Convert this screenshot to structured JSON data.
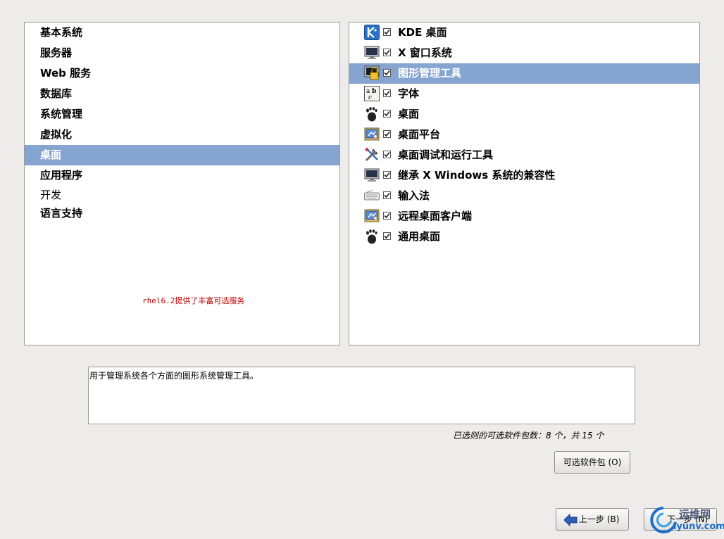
{
  "categories": [
    {
      "label": "基本系统",
      "selected": false,
      "bold": true
    },
    {
      "label": "服务器",
      "selected": false,
      "bold": true
    },
    {
      "label": "Web 服务",
      "selected": false,
      "bold": true
    },
    {
      "label": "数据库",
      "selected": false,
      "bold": true
    },
    {
      "label": "系统管理",
      "selected": false,
      "bold": true
    },
    {
      "label": "虚拟化",
      "selected": false,
      "bold": true
    },
    {
      "label": "桌面",
      "selected": true,
      "bold": true
    },
    {
      "label": "应用程序",
      "selected": false,
      "bold": true
    },
    {
      "label": "开发",
      "selected": false,
      "bold": false
    },
    {
      "label": "语言支持",
      "selected": false,
      "bold": true
    }
  ],
  "annotation": "rhel6.2提供了丰富可选服务",
  "groups": [
    {
      "label": "KDE 桌面",
      "icon": "kde-icon",
      "checked": true,
      "selected": false
    },
    {
      "label": "X 窗口系统",
      "icon": "monitor-icon",
      "checked": true,
      "selected": false
    },
    {
      "label": "图形管理工具",
      "icon": "lock-screen-icon",
      "checked": true,
      "selected": true
    },
    {
      "label": "字体",
      "icon": "font-icon",
      "checked": true,
      "selected": false
    },
    {
      "label": "桌面",
      "icon": "gnome-foot-icon",
      "checked": true,
      "selected": false
    },
    {
      "label": "桌面平台",
      "icon": "desktop-platform-icon",
      "checked": true,
      "selected": false
    },
    {
      "label": "桌面调试和运行工具",
      "icon": "tools-icon",
      "checked": true,
      "selected": false
    },
    {
      "label": "继承 X Windows 系统的兼容性",
      "icon": "monitor-icon",
      "checked": true,
      "selected": false
    },
    {
      "label": "输入法",
      "icon": "keyboard-icon",
      "checked": true,
      "selected": false
    },
    {
      "label": "远程桌面客户端",
      "icon": "desktop-platform-icon",
      "checked": true,
      "selected": false
    },
    {
      "label": "通用桌面",
      "icon": "gnome-foot-icon",
      "checked": true,
      "selected": false
    }
  ],
  "description": "用于管理系统各个方面的图形系统管理工具。",
  "package_count": "已选则的可选软件包数：8 个，共 15 个",
  "buttons": {
    "optional": "可选软件包 (O)",
    "back": "上一步 (B)",
    "next": "下一步 (N)"
  },
  "watermark": {
    "top": "运维网",
    "bottom": "iyunv.com"
  },
  "colors": {
    "selection": "#86a4d0",
    "background": "#edeceb",
    "annotation": "#c00000"
  }
}
